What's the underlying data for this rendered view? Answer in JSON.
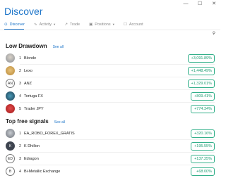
{
  "window": {
    "minimize_glyph": "—",
    "maximize_glyph": "☐",
    "close_glyph": "✕"
  },
  "header": {
    "title": "Discover"
  },
  "tabs": [
    {
      "label": "Discover",
      "icon": "compass-icon",
      "glyph": "⊙",
      "active": true,
      "dropdown": false
    },
    {
      "label": "Activity",
      "icon": "activity-icon",
      "glyph": "∿",
      "active": false,
      "dropdown": true
    },
    {
      "label": "Trade",
      "icon": "trade-icon",
      "glyph": "↗",
      "active": false,
      "dropdown": false
    },
    {
      "label": "Positions",
      "icon": "positions-icon",
      "glyph": "▣",
      "active": false,
      "dropdown": true
    },
    {
      "label": "Account",
      "icon": "account-icon",
      "glyph": "☐",
      "active": false,
      "dropdown": false
    }
  ],
  "search": {
    "icon": "search-icon",
    "glyph": "⚲"
  },
  "low_drawdown": {
    "title": "Low Drawdown",
    "see_all": "See all",
    "items": [
      {
        "rank": "1",
        "name": "Blonde",
        "value": "+3,091.89%",
        "avatar": "photo",
        "initials": ""
      },
      {
        "rank": "2",
        "name": "Lexo",
        "value": "+1,448.49%",
        "avatar": "photo",
        "initials": ""
      },
      {
        "rank": "3",
        "name": "ANZ",
        "value": "+1,329.01%",
        "avatar": "initials",
        "initials": "AN"
      },
      {
        "rank": "4",
        "name": "Tortuga FX",
        "value": "+809.41%",
        "avatar": "photo",
        "initials": ""
      },
      {
        "rank": "5",
        "name": "Trader JPY",
        "value": "+774.34%",
        "avatar": "photo",
        "initials": ""
      }
    ]
  },
  "top_free": {
    "title": "Top free signals",
    "see_all": "See all",
    "items": [
      {
        "rank": "1",
        "name": "EA_ROBO_FOREX_GRATIS",
        "value": "+320.16%",
        "avatar": "photo",
        "initials": ""
      },
      {
        "rank": "2",
        "name": "K Dhillon",
        "value": "+195.55%",
        "avatar": "initials",
        "initials": "K"
      },
      {
        "rank": "3",
        "name": "Edragon",
        "value": "+137.25%",
        "avatar": "initials",
        "initials": "ED"
      },
      {
        "rank": "4",
        "name": "Bi-Metallic Exchange",
        "value": "+68.00%",
        "avatar": "initials",
        "initials": "B"
      }
    ]
  },
  "colors": {
    "accent": "#1a73c8",
    "positive": "#1e9e73"
  }
}
